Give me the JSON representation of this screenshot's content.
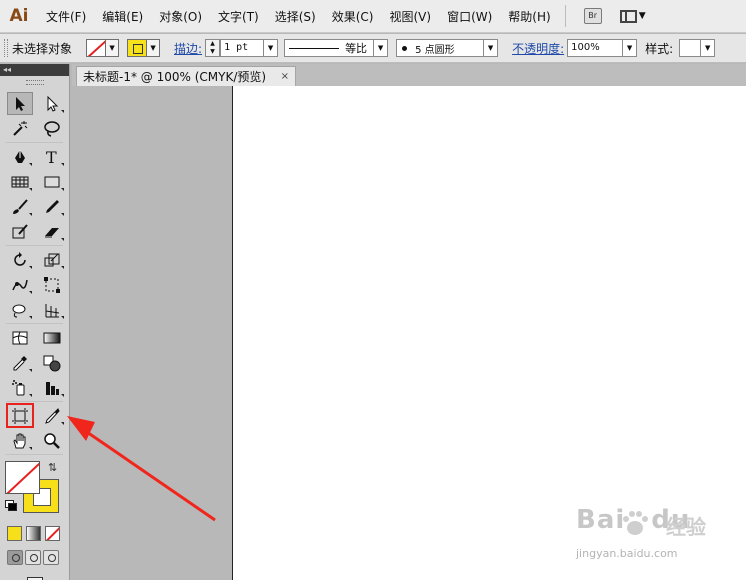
{
  "app": {
    "logo": "Ai"
  },
  "menu": {
    "items": [
      "文件(F)",
      "编辑(E)",
      "对象(O)",
      "文字(T)",
      "选择(S)",
      "效果(C)",
      "视图(V)",
      "窗口(W)",
      "帮助(H)"
    ],
    "bridge_label": "Br"
  },
  "control": {
    "selection_status": "未选择对象",
    "stroke_label": "描边:",
    "stroke_weight": "1 pt",
    "stroke_profile": "等比",
    "brush": "5 点圆形",
    "opacity_label": "不透明度:",
    "opacity_value": "100%",
    "style_label": "样式:"
  },
  "panel": {
    "collapse_glyph": "◂◂"
  },
  "document": {
    "tab_title": "未标题-1* @ 100% (CMYK/预览)",
    "close_glyph": "×"
  },
  "colors": {
    "fill": "none",
    "stroke": "#f7e01a",
    "highlight": "#e8231d",
    "arrow": "#f0261c"
  },
  "tools": [
    [
      "selection-tool-icon",
      "direct-selection-tool-icon"
    ],
    [
      "magic-wand-tool-icon",
      "lasso-tool-icon"
    ],
    [
      "pen-tool-icon",
      "type-tool-icon"
    ],
    [
      "rectangular-grid-tool-icon",
      "rectangle-tool-icon"
    ],
    [
      "paintbrush-tool-icon",
      "pencil-tool-icon"
    ],
    [
      "blob-brush-tool-icon",
      "eraser-tool-icon"
    ],
    [
      "rotate-tool-icon",
      "scale-tool-icon"
    ],
    [
      "warp-tool-icon",
      "free-transform-tool-icon"
    ],
    [
      "shape-builder-tool-icon",
      "perspective-grid-tool-icon"
    ],
    [
      "mesh-tool-icon",
      "gradient-tool-icon"
    ],
    [
      "eyedropper-tool-icon",
      "blend-tool-icon"
    ],
    [
      "symbol-sprayer-tool-icon",
      "column-graph-tool-icon"
    ],
    [
      "artboard-tool-icon",
      "slice-tool-icon"
    ],
    [
      "hand-tool-icon",
      "zoom-tool-icon"
    ]
  ],
  "highlighted_tool": "artboard-tool-icon",
  "watermark": {
    "logo_text": "Bai",
    "logo_text_suffix": "du",
    "cn_text": "经验",
    "url": "jingyan.baidu.com"
  }
}
